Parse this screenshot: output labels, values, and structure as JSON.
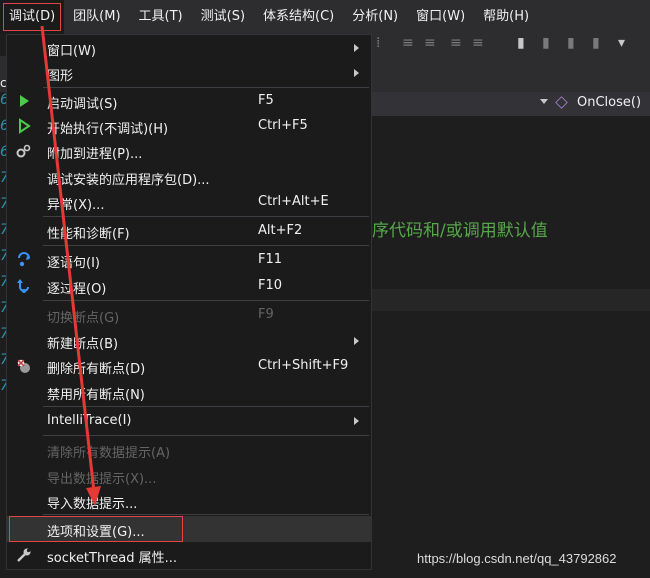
{
  "menubar": {
    "items": [
      "调试(D)",
      "团队(M)",
      "工具(T)",
      "测试(S)",
      "体系结构(C)",
      "分析(N)",
      "窗口(W)",
      "帮助(H)"
    ]
  },
  "left_tab": "c",
  "gutter_digits": [
    "6",
    "6",
    "6",
    "7",
    "7",
    "7",
    "7",
    "7",
    "7",
    "7",
    "7",
    "7"
  ],
  "navbar": {
    "function_name": "OnClose()"
  },
  "editor": {
    "comment_text": "序代码和/或调用默认值"
  },
  "debug_menu": {
    "items": [
      {
        "label": "窗口(W)",
        "shortcut": "",
        "submenu": true
      },
      {
        "label": "图形",
        "shortcut": "",
        "submenu": true
      },
      {
        "label": "启动调试(S)",
        "shortcut": "F5",
        "icon": "play-icon"
      },
      {
        "label": "开始执行(不调试)(H)",
        "shortcut": "Ctrl+F5",
        "icon": "play-outline-icon"
      },
      {
        "label": "附加到进程(P)...",
        "shortcut": "",
        "icon": "gears-icon"
      },
      {
        "label": "调试安装的应用程序包(D)...",
        "shortcut": ""
      },
      {
        "label": "异常(X)...",
        "shortcut": "Ctrl+Alt+E"
      },
      {
        "label": "性能和诊断(F)",
        "shortcut": "Alt+F2"
      },
      {
        "label": "逐语句(I)",
        "shortcut": "F11",
        "icon": "step-into-icon"
      },
      {
        "label": "逐过程(O)",
        "shortcut": "F10",
        "icon": "step-over-icon"
      },
      {
        "label": "切换断点(G)",
        "shortcut": "F9",
        "disabled": true
      },
      {
        "label": "新建断点(B)",
        "shortcut": "",
        "submenu": true
      },
      {
        "label": "删除所有断点(D)",
        "shortcut": "Ctrl+Shift+F9",
        "icon": "delete-breakpoints-icon"
      },
      {
        "label": "禁用所有断点(N)",
        "shortcut": ""
      },
      {
        "label": "IntelliTrace(I)",
        "shortcut": "",
        "submenu": true
      },
      {
        "label": "清除所有数据提示(A)",
        "shortcut": "",
        "disabled": true
      },
      {
        "label": "导出数据提示(X)...",
        "shortcut": "",
        "disabled": true
      },
      {
        "label": "导入数据提示...",
        "shortcut": ""
      },
      {
        "label": "选项和设置(G)...",
        "shortcut": ""
      },
      {
        "label": "socketThread 属性...",
        "shortcut": "",
        "icon": "wrench-icon"
      }
    ]
  },
  "watermark": "https://blog.csdn.net/qq_43792862",
  "colors": {
    "highlight_box": "#e04646",
    "accent_green": "#57a64a",
    "icon_blue": "#3794ff"
  }
}
